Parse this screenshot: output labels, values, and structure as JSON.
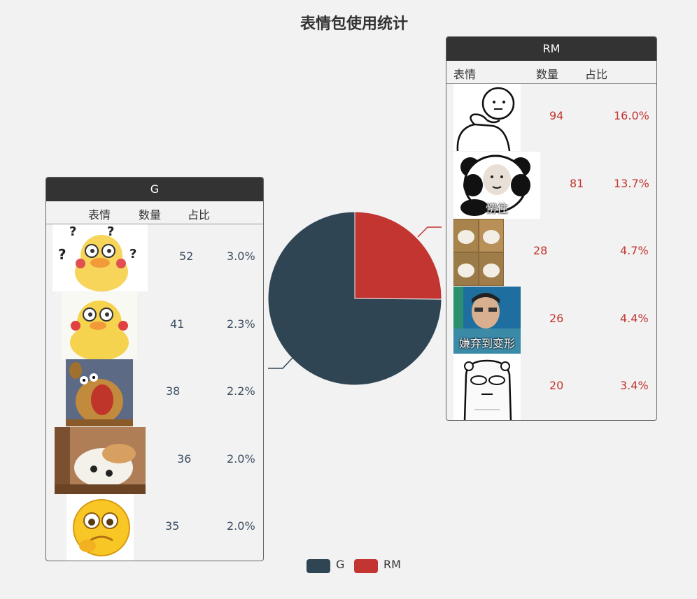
{
  "chart_data": {
    "type": "pie",
    "title": "表情包使用统计",
    "series": [
      {
        "name": "G",
        "value": 1750,
        "color": "#2f4554"
      },
      {
        "name": "RM",
        "value": 588,
        "color": "#c23531"
      }
    ],
    "legend": [
      "G",
      "RM"
    ],
    "legend_position": "bottom"
  },
  "panels": {
    "g": {
      "header": "G",
      "columns": [
        "表情",
        "数量",
        "占比"
      ],
      "rows": [
        {
          "count": "52",
          "pct": "3.0%",
          "icon": "duck-question-sticker"
        },
        {
          "count": "41",
          "pct": "2.3%",
          "icon": "duck-sticker"
        },
        {
          "count": "38",
          "pct": "2.2%",
          "icon": "screaming-mouse-sticker"
        },
        {
          "count": "36",
          "pct": "2.0%",
          "icon": "cat-photo-sticker"
        },
        {
          "count": "35",
          "pct": "2.0%",
          "icon": "shy-emoji-sticker"
        }
      ]
    },
    "rm": {
      "header": "RM",
      "columns": [
        "表情",
        "数量",
        "占比"
      ],
      "rows": [
        {
          "count": "94",
          "pct": "16.0%",
          "icon": "stickman-pat-sticker"
        },
        {
          "count": "81",
          "pct": "13.7%",
          "icon": "panda-face-sticker",
          "caption": "愣住"
        },
        {
          "count": "28",
          "pct": "4.7%",
          "icon": "cat-grid-sticker"
        },
        {
          "count": "26",
          "pct": "4.4%",
          "icon": "man-face-sticker",
          "caption": "嫌弃到变形"
        },
        {
          "count": "20",
          "pct": "3.4%",
          "icon": "bear-doodle-sticker"
        }
      ]
    }
  },
  "colors": {
    "g": "#2f4554",
    "rm": "#c23531",
    "header_bg": "#333333",
    "background": "#f2f2f2"
  }
}
